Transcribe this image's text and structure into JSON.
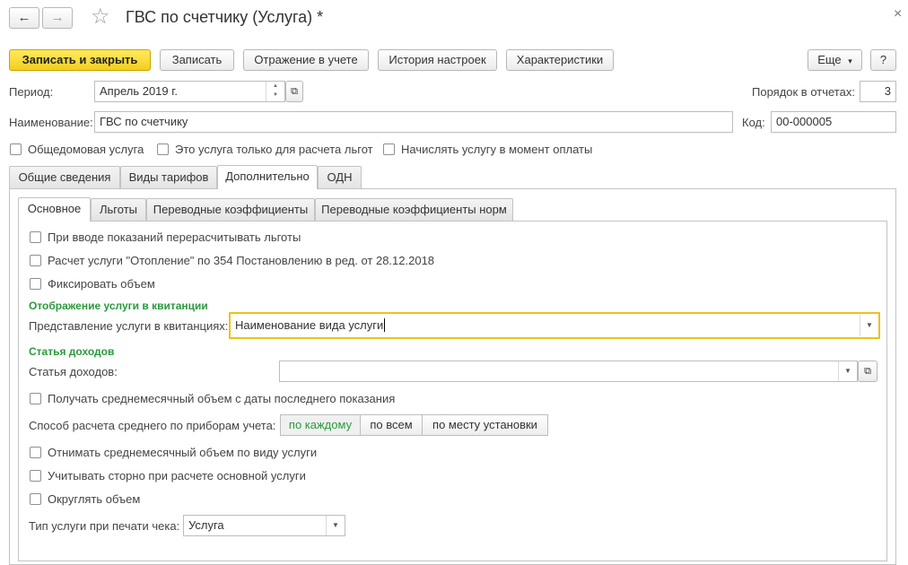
{
  "window": {
    "title": "ГВС по счетчику (Услуга) *",
    "back_icon": "←",
    "forward_icon": "→",
    "star_icon": "☆",
    "close_icon": "×"
  },
  "toolbar": {
    "save_close": "Записать и закрыть",
    "save": "Записать",
    "reflection": "Отражение в учете",
    "history": "История настроек",
    "characteristics": "Характеристики",
    "more": "Еще",
    "more_arrow": "▾",
    "help": "?"
  },
  "fields": {
    "period_label": "Период:",
    "period_value": "Апрель 2019 г.",
    "order_label": "Порядок в отчетах:",
    "order_value": "3",
    "name_label": "Наименование:",
    "name_value": "ГВС по счетчику",
    "code_label": "Код:",
    "code_value": "00-000005"
  },
  "checkboxes": {
    "common_house": "Общедомовая услуга",
    "benefits_only": "Это услуга только для расчета льгот",
    "charge_on_payment": "Начислять услугу в момент оплаты"
  },
  "tabs": [
    "Общие сведения",
    "Виды тарифов",
    "Дополнительно",
    "ОДН"
  ],
  "subtabs": [
    "Основное",
    "Льготы",
    "Переводные коэффициенты",
    "Переводные коэффициенты норм"
  ],
  "main": {
    "recalc_benefits": "При вводе показаний перерасчитывать льготы",
    "heating_calc": "Расчет услуги \"Отопление\" по 354 Постановлению в ред. от 28.12.2018",
    "fix_volume": "Фиксировать объем",
    "receipt_section": "Отображение услуги в квитанции",
    "receipt_label": "Представление услуги в квитанциях:",
    "receipt_value": "Наименование вида услуги",
    "income_section": "Статья доходов",
    "income_label": "Статья доходов:",
    "income_value": "",
    "avg_from_last": "Получать среднемесячный объем с даты последнего показания",
    "avg_method_label": "Способ расчета среднего по приборам учета:",
    "avg_methods": [
      "по каждому",
      "по всем",
      "по месту установки"
    ],
    "subtract_avg": "Отнимать среднемесячный объем по виду услуги",
    "storno": "Учитывать сторно при расчете основной услуги",
    "round_volume": "Округлять объем",
    "receipt_type_label": "Тип услуги при печати чека:",
    "receipt_type_value": "Услуга"
  },
  "colors": {
    "accent_yellow": "#f5cd1c",
    "section_green": "#2a9a3c",
    "focus_border": "#e9c31a"
  }
}
